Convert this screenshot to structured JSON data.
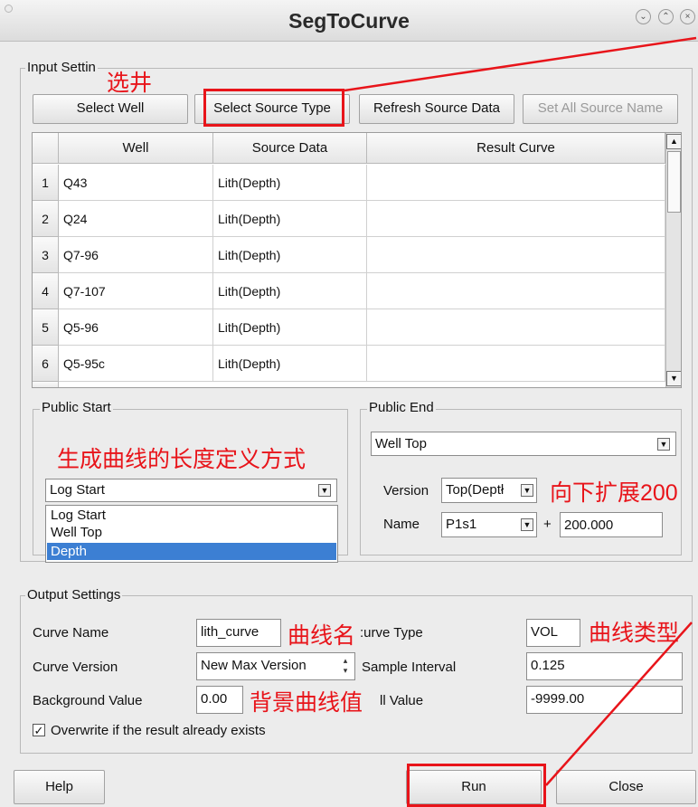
{
  "window": {
    "title": "SegToCurve"
  },
  "input_settings": {
    "legend": "Input Settin",
    "buttons": {
      "select_well": "Select Well",
      "select_source_type": "Select Source Type",
      "refresh_source_data": "Refresh Source Data",
      "set_all_source_name": "Set All Source Name"
    },
    "table": {
      "columns": [
        "Well",
        "Source Data",
        "Result Curve"
      ],
      "rows": [
        {
          "num": "1",
          "well": "Q43",
          "source": "Lith(Depth)",
          "result": ""
        },
        {
          "num": "2",
          "well": "Q24",
          "source": "Lith(Depth)",
          "result": ""
        },
        {
          "num": "3",
          "well": "Q7-96",
          "source": "Lith(Depth)",
          "result": ""
        },
        {
          "num": "4",
          "well": "Q7-107",
          "source": "Lith(Depth)",
          "result": ""
        },
        {
          "num": "5",
          "well": "Q5-96",
          "source": "Lith(Depth)",
          "result": ""
        },
        {
          "num": "6",
          "well": "Q5-95c",
          "source": "Lith(Depth)",
          "result": ""
        }
      ]
    }
  },
  "public_start": {
    "legend": "Public Start",
    "selected": "Log Start",
    "options": [
      "Log Start",
      "Well Top",
      "Depth"
    ],
    "highlighted": "Depth"
  },
  "public_end": {
    "legend": "Public End",
    "selected": "Well Top",
    "version_label": "Version",
    "version_value": "Top(Deptł",
    "name_label": "Name",
    "name_value": "P1s1",
    "plus": "+",
    "offset_value": "200.000"
  },
  "output_settings": {
    "legend": "Output Settings",
    "curve_name_label": "Curve Name",
    "curve_name_value": "lith_curve",
    "curve_type_label": "Curve Type",
    "curve_type_visible": ":urve Type",
    "curve_type_value": "VOL",
    "curve_version_label": "Curve Version",
    "curve_version_value": "New Max Version",
    "sample_interval_label": "Sample Interval",
    "sample_interval_value": "0.125",
    "background_value_label": "Background Value",
    "background_value_value": "0.00",
    "null_value_visible": "ll Value",
    "null_value_value": "-9999.00",
    "overwrite_label": "Overwrite if the result already exists",
    "overwrite_checked": true
  },
  "footer": {
    "help": "Help",
    "run": "Run",
    "close": "Close"
  },
  "annotations": {
    "select_well": "选井",
    "length_definition": "生成曲线的长度定义方式",
    "extend_down": "向下扩展200",
    "curve_name": "曲线名",
    "background_value": "背景曲线值",
    "curve_type": "曲线类型",
    "color": "#e8141a"
  },
  "icons": {
    "minimize": "chevron-down-icon",
    "maximize": "chevron-up-icon",
    "close": "close-icon",
    "combo": "triangle-down-icon",
    "checkbox": "checkmark-icon"
  }
}
